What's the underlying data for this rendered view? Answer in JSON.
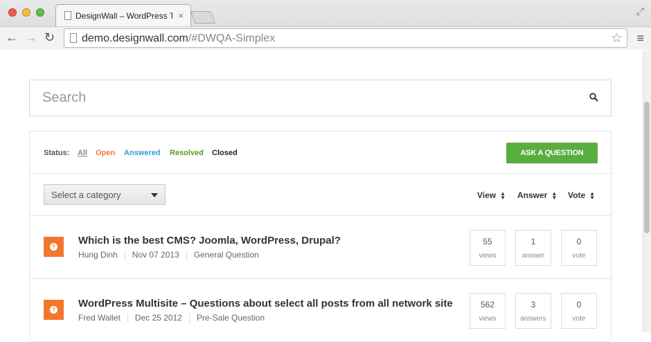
{
  "browser": {
    "tab_title": "DesignWall – WordPress Th",
    "tab_close": "×",
    "url_host": "demo.designwall.com",
    "url_path": "/#DWQA-Simplex"
  },
  "search": {
    "placeholder": "Search"
  },
  "status_bar": {
    "label": "Status:",
    "filters": [
      "All",
      "Open",
      "Answered",
      "Resolved",
      "Closed"
    ],
    "ask_button": "ASK A QUESTION"
  },
  "filter_bar": {
    "category_placeholder": "Select a category",
    "sort_view": "View",
    "sort_answer": "Answer",
    "sort_vote": "Vote"
  },
  "questions": [
    {
      "title": "Which is the best CMS? Joomla, WordPress, Drupal?",
      "author": "Hung Dinh",
      "date": "Nov 07 2013",
      "category": "General Question",
      "views": "55",
      "views_label": "views",
      "answers": "1",
      "answers_label": "answer",
      "votes": "0",
      "votes_label": "vote"
    },
    {
      "title": "WordPress Multisite – Questions about select all posts from all network site",
      "author": "Fred Wallet",
      "date": "Dec 25 2012",
      "category": "Pre-Sale Question",
      "views": "562",
      "views_label": "views",
      "answers": "3",
      "answers_label": "answers",
      "votes": "0",
      "votes_label": "vote"
    }
  ],
  "colors": {
    "open": "#f0782e",
    "answered": "#2aa0d8",
    "resolved": "#5b9a1f",
    "ask_button": "#5aad3f"
  }
}
